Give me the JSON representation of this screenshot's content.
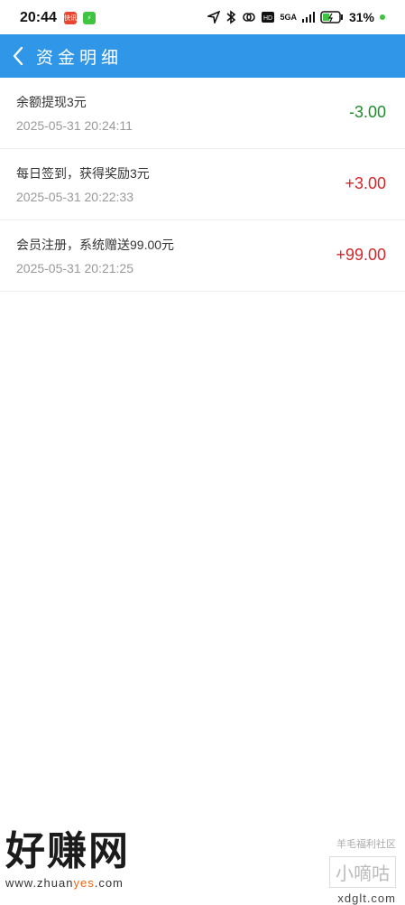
{
  "status_bar": {
    "time": "20:44",
    "network": "5GA",
    "battery": "31%",
    "badge_red": "快讯",
    "badge_green": "⚡"
  },
  "header": {
    "title": "资金明细"
  },
  "transactions": [
    {
      "title": "余额提现3元",
      "time": "2025-05-31 20:24:11",
      "amount": "-3.00",
      "type": "negative"
    },
    {
      "title": "每日签到，获得奖励3元",
      "time": "2025-05-31 20:22:33",
      "amount": "+3.00",
      "type": "positive"
    },
    {
      "title": "会员注册，系统赠送99.00元",
      "time": "2025-05-31 20:21:25",
      "amount": "+99.00",
      "type": "positive"
    }
  ],
  "watermark": {
    "left_big": "好赚网",
    "left_url_1": "www.zhuan",
    "left_url_2": "yes",
    "left_url_3": ".com",
    "right_small": "羊毛福利社区",
    "right_big": "小嘀咕",
    "right_url": "xdglt.com"
  },
  "colors": {
    "header_bg": "#2f96e8",
    "negative_amount": "#1e8c2a",
    "positive_amount": "#d0272b"
  }
}
